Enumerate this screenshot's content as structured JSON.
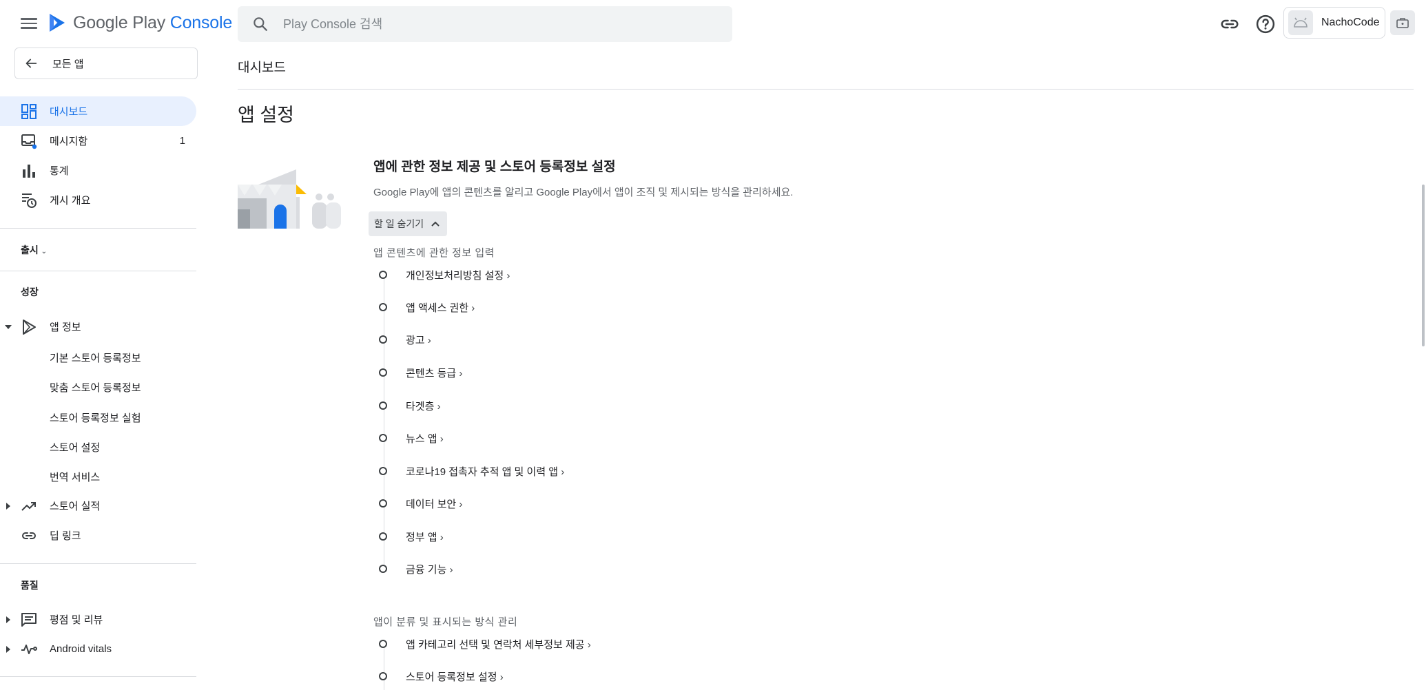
{
  "header": {
    "logo_text_main": "Google Play",
    "logo_text_accent": "Console",
    "search_placeholder": "Play Console 검색",
    "account_name": "NachoCode"
  },
  "sidebar": {
    "back_label": "모든 앱",
    "items": [
      {
        "label": "대시보드",
        "icon": "dashboard-icon",
        "active": true
      },
      {
        "label": "메시지함",
        "icon": "inbox-icon",
        "badge": "1"
      },
      {
        "label": "통계",
        "icon": "bar-chart-icon"
      },
      {
        "label": "게시 개요",
        "icon": "publishing-overview-icon"
      }
    ],
    "release_label": "출시",
    "growth_label": "성장",
    "app_info_label": "앱 정보",
    "app_info_sub": [
      "기본 스토어 등록정보",
      "맞춤 스토어 등록정보",
      "스토어 등록정보 실험",
      "스토어 설정",
      "번역 서비스"
    ],
    "store_performance_label": "스토어 실적",
    "deep_links_label": "딥 링크",
    "quality_label": "품질",
    "ratings_label": "평점 및 리뷰",
    "vitals_label": "Android vitals"
  },
  "main": {
    "breadcrumb": "대시보드",
    "page_title": "앱 설정",
    "card_title": "앱에 관한 정보 제공 및 스토어 등록정보 설정",
    "card_desc": "Google Play에 앱의 콘텐츠를 알리고 Google Play에서 앱이 조직 및 제시되는 방식을 관리하세요.",
    "hide_tasks_label": "할 일 숨기기",
    "group1_label": "앱 콘텐츠에 관한 정보 입력",
    "group1_tasks": [
      "개인정보처리방침 설정",
      "앱 액세스 권한",
      "광고",
      "콘텐츠 등급",
      "타겟층",
      "뉴스 앱",
      "코로나19 접촉자 추적 앱 및 이력 앱",
      "데이터 보안",
      "정부 앱",
      "금융 기능"
    ],
    "group2_label": "앱이 분류 및 표시되는 방식 관리",
    "group2_tasks": [
      "앱 카테고리 선택 및 연락처 세부정보 제공",
      "스토어 등록정보 설정"
    ]
  },
  "colors": {
    "accent": "#1a73e8",
    "active_bg": "#e8f0fe",
    "illustration_yellow": "#fbbc04"
  }
}
